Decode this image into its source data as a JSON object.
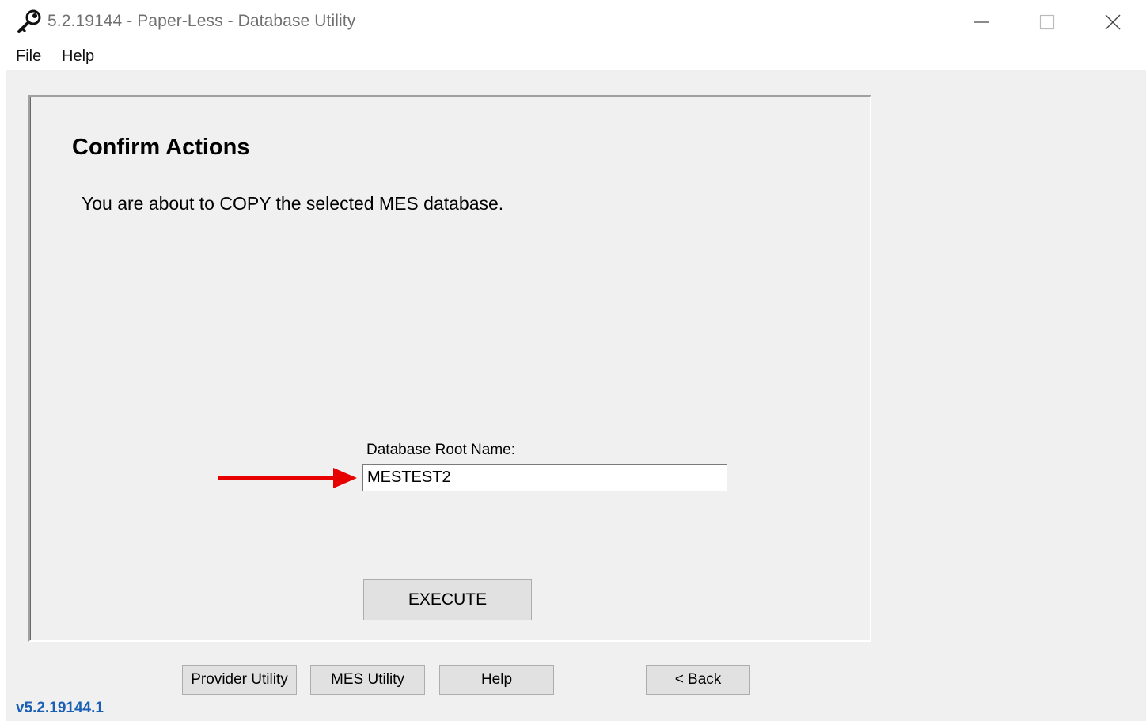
{
  "window": {
    "title": "5.2.19144 - Paper-Less - Database Utility",
    "icon": "key-wrench-icon"
  },
  "menu": {
    "items": [
      "File",
      "Help"
    ]
  },
  "panel": {
    "title": "Confirm Actions",
    "message": "You are about to COPY the selected MES database.",
    "field_label": "Database Root Name:",
    "field_value": "MESTEST2",
    "execute_label": "EXECUTE",
    "arrow_color": "#e60000"
  },
  "buttons": {
    "provider_utility": "Provider Utility",
    "mes_utility": "MES Utility",
    "help": "Help",
    "back": "< Back"
  },
  "version": "v5.2.19144.1"
}
